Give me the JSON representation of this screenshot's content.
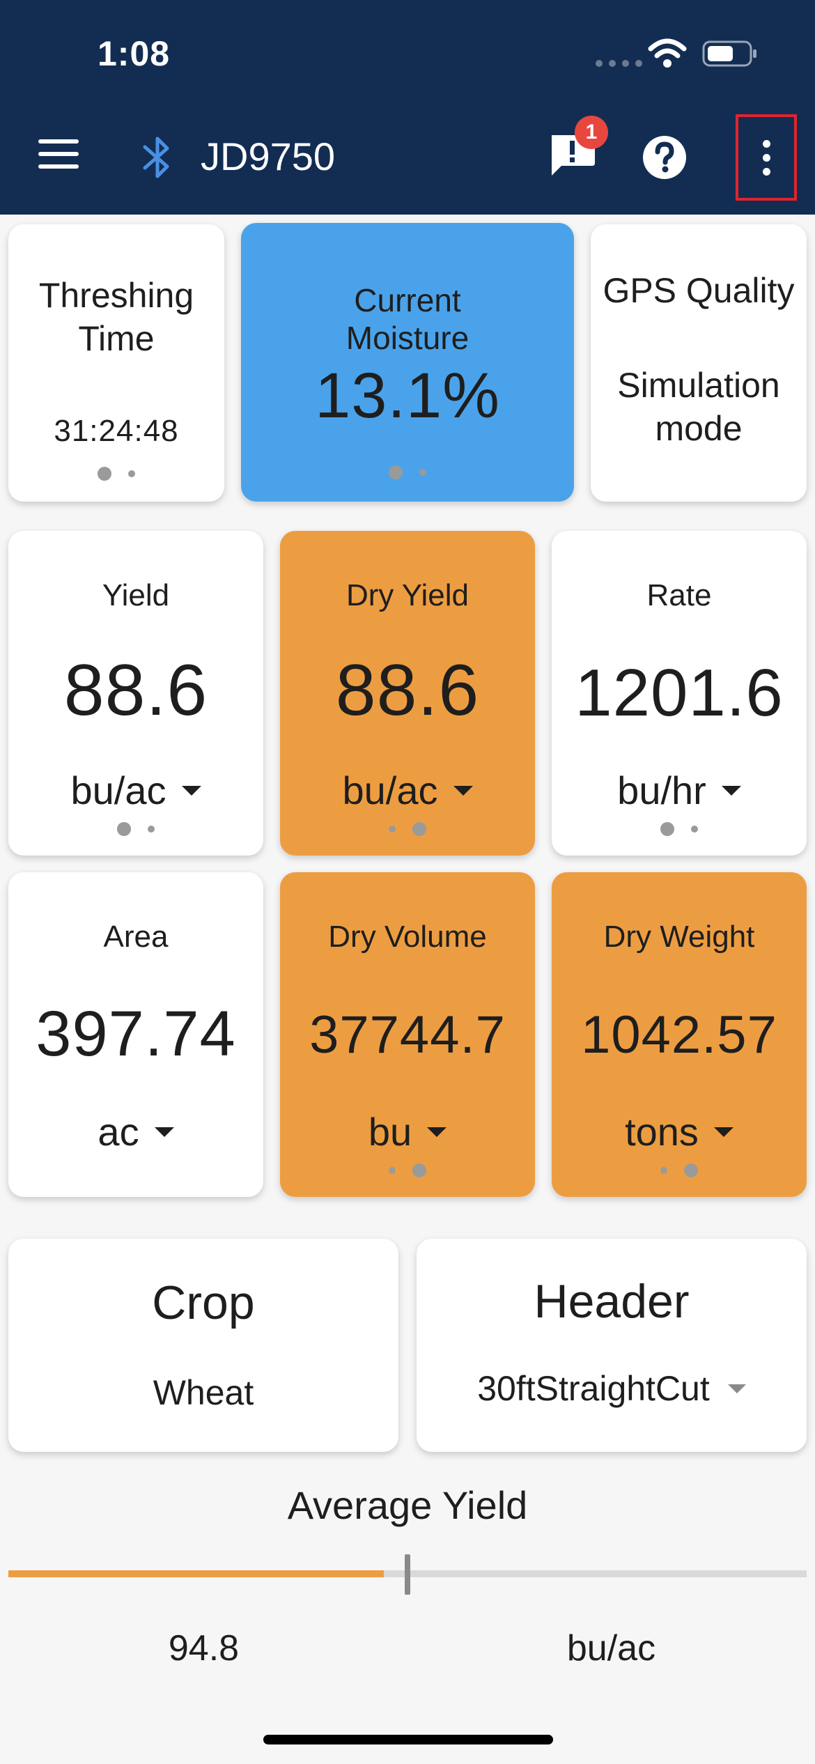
{
  "status_bar": {
    "time": "1:08"
  },
  "app_bar": {
    "device_name": "JD9750",
    "alert_count": "1"
  },
  "status_cards": {
    "threshing": {
      "title_line1": "Threshing",
      "title_line2": "Time",
      "value": "31:24:48"
    },
    "moisture": {
      "title_line1": "Current",
      "title_line2": "Moisture",
      "value": "13.1%"
    },
    "gps": {
      "title": "GPS Quality",
      "value_line1": "Simulation",
      "value_line2": "mode"
    }
  },
  "metrics": {
    "yield": {
      "title": "Yield",
      "value": "88.6",
      "unit": "bu/ac"
    },
    "dry_yield": {
      "title": "Dry Yield",
      "value": "88.6",
      "unit": "bu/ac"
    },
    "rate": {
      "title": "Rate",
      "value": "1201.6",
      "unit": "bu/hr"
    },
    "area": {
      "title": "Area",
      "value": "397.74",
      "unit": "ac"
    },
    "dry_volume": {
      "title": "Dry Volume",
      "value": "37744.7",
      "unit": "bu"
    },
    "dry_weight": {
      "title": "Dry Weight",
      "value": "1042.57",
      "unit": "tons"
    }
  },
  "crop": {
    "title": "Crop",
    "value": "Wheat"
  },
  "header_card": {
    "title": "Header",
    "value": "30ftStraightCut"
  },
  "average_yield": {
    "title": "Average Yield",
    "value": "94.8",
    "unit": "bu/ac",
    "slider_fill_fraction": 0.47
  },
  "colors": {
    "app_bar": "#132d52",
    "moisture_card": "#4aa3ea",
    "dry_card": "#ed9d41",
    "alert_badge": "#e8473f",
    "highlight_box": "#e0242e",
    "bluetooth": "#4a90e2"
  },
  "icons": [
    "menu-icon",
    "bluetooth-icon",
    "alert-message-icon",
    "help-icon",
    "more-vert-icon",
    "wifi-icon",
    "battery-icon"
  ]
}
